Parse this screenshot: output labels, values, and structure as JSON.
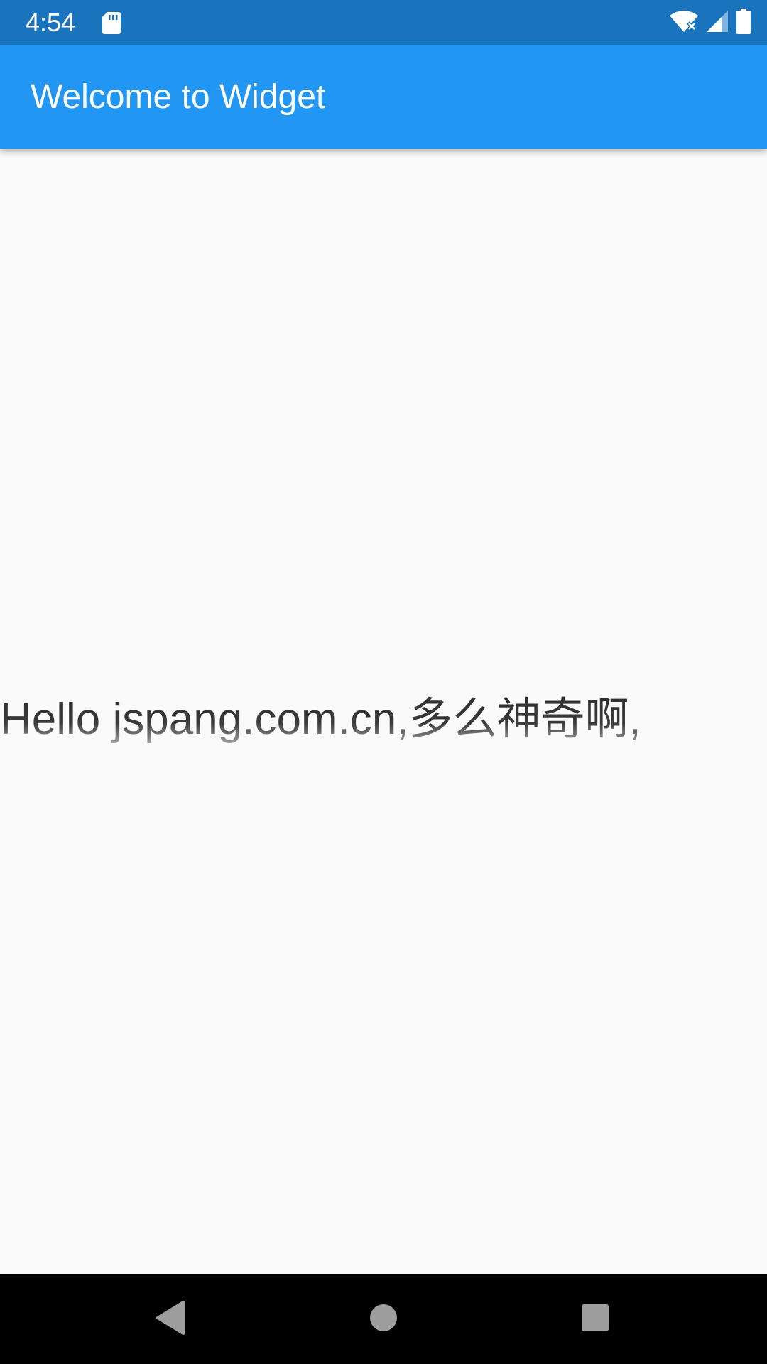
{
  "status_bar": {
    "time": "4:54",
    "icons": [
      "sd-card-icon",
      "wifi-off-icon",
      "signal-icon",
      "battery-icon"
    ],
    "background": "#1a74bd"
  },
  "app_bar": {
    "title": "Welcome to Widget",
    "background": "#2196f3"
  },
  "main": {
    "text": "Hello jspang.com.cn,多么神奇啊,"
  },
  "nav_bar": {
    "buttons": [
      "back-icon",
      "home-icon",
      "recents-icon"
    ],
    "background": "#000000"
  }
}
